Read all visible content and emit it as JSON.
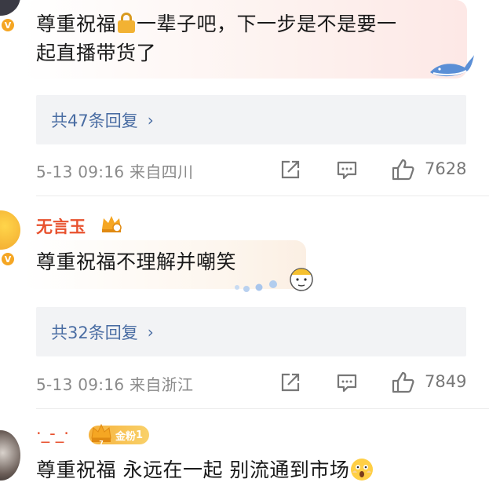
{
  "comments": [
    {
      "text_before_lock": "尊重祝福",
      "text_after_lock": "一辈子吧，下一步是不是要一",
      "text_line2": "起直播带货了",
      "replies_label": "共47条回复",
      "meta": "5-13 09:16  来自四川",
      "likes": "7628"
    },
    {
      "username": "无言玉",
      "text": "尊重祝福不理解并嘲笑",
      "replies_label": "共32条回复",
      "meta": "5-13 09:16  来自浙江",
      "likes": "7849"
    },
    {
      "username": "·_-_·",
      "fan_badge": "金粉",
      "fan_badge_level": "1",
      "crown_level": "7",
      "text": "尊重祝福 永远在一起 别流通到市场"
    }
  ],
  "colors": {
    "reply_link": "#4a6da3",
    "username": "#e8522f",
    "meta_gray": "#8a8a8a",
    "reply_bg": "#f2f3f5",
    "badge_gold": "#f5a623"
  },
  "icons": [
    "lock-icon",
    "chevron-right-icon",
    "share-icon",
    "comment-icon",
    "thumbs-up-icon",
    "crown-icon",
    "verified-badge-icon",
    "fan-medal-icon",
    "scared-face-emoji"
  ]
}
